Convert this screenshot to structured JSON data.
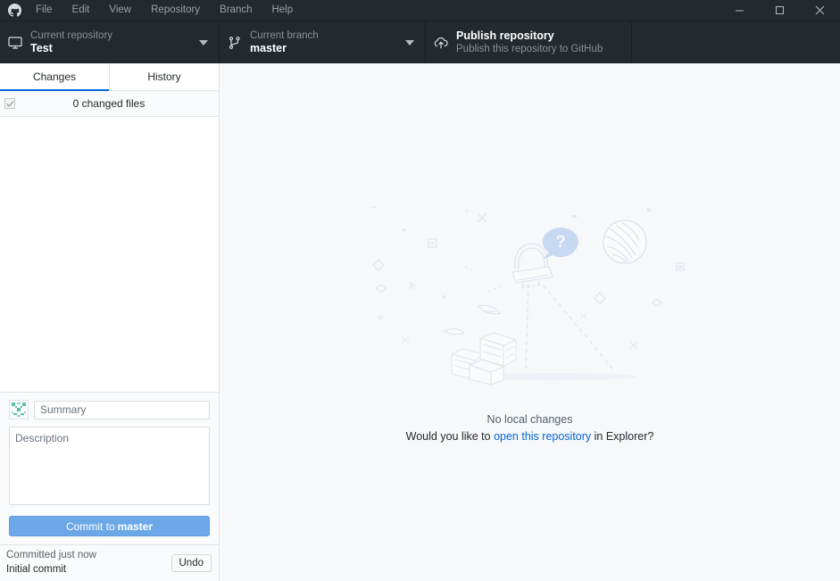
{
  "titlebar": {
    "logo_icon": "github-mark-icon",
    "menus": [
      {
        "label": "File"
      },
      {
        "label": "Edit"
      },
      {
        "label": "View"
      },
      {
        "label": "Repository"
      },
      {
        "label": "Branch"
      },
      {
        "label": "Help"
      }
    ],
    "window_controls": {
      "minimize_icon": "minimize-icon",
      "maximize_icon": "maximize-icon",
      "close_icon": "close-icon"
    }
  },
  "toolbar": {
    "repository": {
      "icon": "desktop-monitor-icon",
      "label": "Current repository",
      "value": "Test",
      "chevron_icon": "chevron-down-icon"
    },
    "branch": {
      "icon": "git-branch-icon",
      "label": "Current branch",
      "value": "master",
      "chevron_icon": "chevron-down-icon"
    },
    "publish": {
      "icon": "cloud-upload-icon",
      "title": "Publish repository",
      "subtitle": "Publish this repository to GitHub"
    }
  },
  "sidebar": {
    "tabs": [
      {
        "label": "Changes",
        "active": true
      },
      {
        "label": "History",
        "active": false
      }
    ],
    "changes_header": {
      "checkbox_state": "checked",
      "checkbox_icon": "checkmark-icon",
      "count_text": "0 changed files"
    },
    "commit_form": {
      "avatar_icon": "identicon-avatar",
      "summary_value": "",
      "summary_placeholder": "Summary",
      "description_value": "",
      "description_placeholder": "Description",
      "commit_button_prefix": "Commit to",
      "commit_button_branch": "master"
    },
    "undo_bar": {
      "status": "Committed just now",
      "commit_message": "Initial commit",
      "undo_label": "Undo"
    }
  },
  "main": {
    "illustration": "ufo-light-cone-blankslate",
    "no_changes_text": "No local changes",
    "prompt_prefix": "Would you like to ",
    "prompt_link": "open this repository",
    "prompt_suffix": " in Explorer?"
  },
  "colors": {
    "titlebar_bg": "#24292e",
    "toolbar_bg": "#24292e",
    "accent_blue": "#0366d6",
    "commit_button_bg": "#6ca7e8",
    "main_bg": "#f6f8fa",
    "sidebar_bg": "#ffffff",
    "border": "#e1e4e8",
    "muted_text": "#586069",
    "illustration_line": "#d6dde7",
    "illustration_bubble": "#c7d9f2"
  }
}
